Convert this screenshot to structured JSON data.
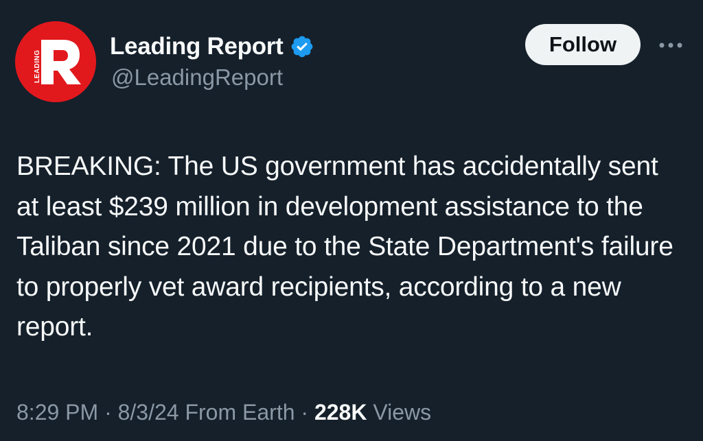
{
  "account": {
    "display_name": "Leading Report",
    "handle": "@LeadingReport",
    "verified": true,
    "avatar": {
      "logo_letter": "R",
      "logo_side_text": "LEADING",
      "bg_color": "#e1191d"
    }
  },
  "actions": {
    "follow_label": "Follow",
    "more_icon": "more-horizontal-icon"
  },
  "tweet": {
    "text": "BREAKING: The US government has accidentally sent at least $239 million in development assistance to the Taliban since 2021 due to the State Department's failure to properly vet award recipients, according to a new report."
  },
  "meta": {
    "time": "8:29 PM",
    "sep1": " · ",
    "date": "8/3/24",
    "source": " From Earth",
    "sep2": " · ",
    "views_count": "228K",
    "views_label": " Views"
  },
  "colors": {
    "background": "#15202b",
    "text_primary": "#f7f9f9",
    "text_secondary": "#8b98a5",
    "verified_badge": "#1d9bf0",
    "follow_bg": "#eff3f4"
  }
}
